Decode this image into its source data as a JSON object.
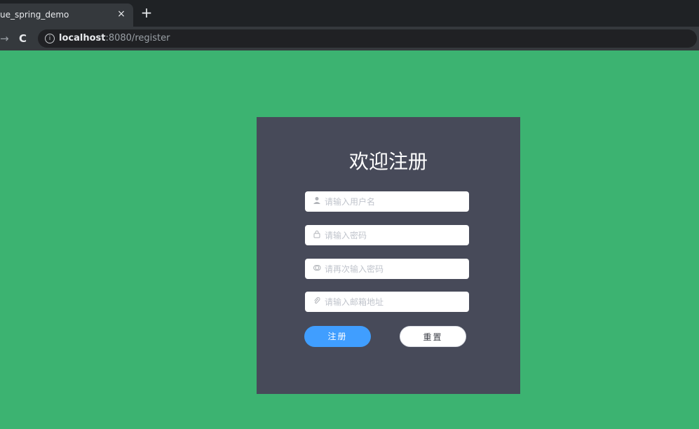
{
  "browser": {
    "tab_title": "ue_spring_demo",
    "tab_close": "×",
    "new_tab": "+",
    "nav_forward": "→",
    "nav_reload": "C",
    "info_icon": "i",
    "url_host": "localhost",
    "url_path": ":8080/register"
  },
  "page": {
    "background_color": "#3cb371",
    "card_color": "#474a59",
    "title": "欢迎注册"
  },
  "form": {
    "username": {
      "icon": "user-icon",
      "placeholder": "请输入用户名",
      "value": ""
    },
    "password": {
      "icon": "lock-icon",
      "placeholder": "请输入密码",
      "value": ""
    },
    "password_confirm": {
      "icon": "circle-check-icon",
      "placeholder": "请再次输入密码",
      "value": ""
    },
    "email": {
      "icon": "paperclip-icon",
      "placeholder": "请输入邮箱地址",
      "value": ""
    }
  },
  "buttons": {
    "register_label": "注册",
    "reset_label": "重置",
    "primary_color": "#409eff"
  }
}
